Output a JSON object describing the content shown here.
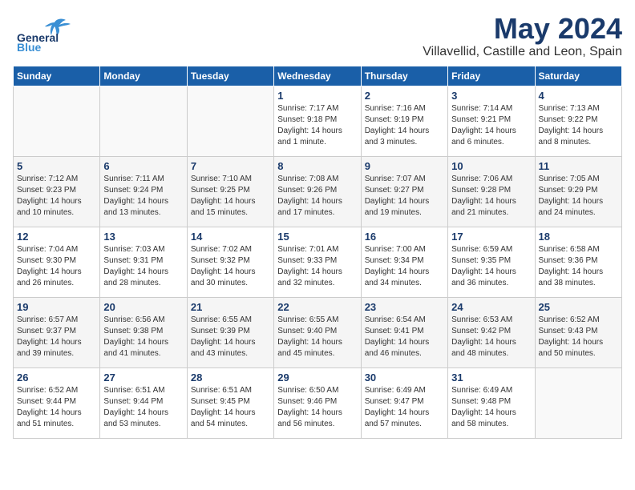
{
  "header": {
    "logo_general": "General",
    "logo_blue": "Blue",
    "title": "May 2024",
    "subtitle": "Villavellid, Castille and Leon, Spain"
  },
  "days_of_week": [
    "Sunday",
    "Monday",
    "Tuesday",
    "Wednesday",
    "Thursday",
    "Friday",
    "Saturday"
  ],
  "weeks": [
    [
      {
        "num": "",
        "sunrise": "",
        "sunset": "",
        "daylight": ""
      },
      {
        "num": "",
        "sunrise": "",
        "sunset": "",
        "daylight": ""
      },
      {
        "num": "",
        "sunrise": "",
        "sunset": "",
        "daylight": ""
      },
      {
        "num": "1",
        "sunrise": "Sunrise: 7:17 AM",
        "sunset": "Sunset: 9:18 PM",
        "daylight": "Daylight: 14 hours and 1 minute."
      },
      {
        "num": "2",
        "sunrise": "Sunrise: 7:16 AM",
        "sunset": "Sunset: 9:19 PM",
        "daylight": "Daylight: 14 hours and 3 minutes."
      },
      {
        "num": "3",
        "sunrise": "Sunrise: 7:14 AM",
        "sunset": "Sunset: 9:21 PM",
        "daylight": "Daylight: 14 hours and 6 minutes."
      },
      {
        "num": "4",
        "sunrise": "Sunrise: 7:13 AM",
        "sunset": "Sunset: 9:22 PM",
        "daylight": "Daylight: 14 hours and 8 minutes."
      }
    ],
    [
      {
        "num": "5",
        "sunrise": "Sunrise: 7:12 AM",
        "sunset": "Sunset: 9:23 PM",
        "daylight": "Daylight: 14 hours and 10 minutes."
      },
      {
        "num": "6",
        "sunrise": "Sunrise: 7:11 AM",
        "sunset": "Sunset: 9:24 PM",
        "daylight": "Daylight: 14 hours and 13 minutes."
      },
      {
        "num": "7",
        "sunrise": "Sunrise: 7:10 AM",
        "sunset": "Sunset: 9:25 PM",
        "daylight": "Daylight: 14 hours and 15 minutes."
      },
      {
        "num": "8",
        "sunrise": "Sunrise: 7:08 AM",
        "sunset": "Sunset: 9:26 PM",
        "daylight": "Daylight: 14 hours and 17 minutes."
      },
      {
        "num": "9",
        "sunrise": "Sunrise: 7:07 AM",
        "sunset": "Sunset: 9:27 PM",
        "daylight": "Daylight: 14 hours and 19 minutes."
      },
      {
        "num": "10",
        "sunrise": "Sunrise: 7:06 AM",
        "sunset": "Sunset: 9:28 PM",
        "daylight": "Daylight: 14 hours and 21 minutes."
      },
      {
        "num": "11",
        "sunrise": "Sunrise: 7:05 AM",
        "sunset": "Sunset: 9:29 PM",
        "daylight": "Daylight: 14 hours and 24 minutes."
      }
    ],
    [
      {
        "num": "12",
        "sunrise": "Sunrise: 7:04 AM",
        "sunset": "Sunset: 9:30 PM",
        "daylight": "Daylight: 14 hours and 26 minutes."
      },
      {
        "num": "13",
        "sunrise": "Sunrise: 7:03 AM",
        "sunset": "Sunset: 9:31 PM",
        "daylight": "Daylight: 14 hours and 28 minutes."
      },
      {
        "num": "14",
        "sunrise": "Sunrise: 7:02 AM",
        "sunset": "Sunset: 9:32 PM",
        "daylight": "Daylight: 14 hours and 30 minutes."
      },
      {
        "num": "15",
        "sunrise": "Sunrise: 7:01 AM",
        "sunset": "Sunset: 9:33 PM",
        "daylight": "Daylight: 14 hours and 32 minutes."
      },
      {
        "num": "16",
        "sunrise": "Sunrise: 7:00 AM",
        "sunset": "Sunset: 9:34 PM",
        "daylight": "Daylight: 14 hours and 34 minutes."
      },
      {
        "num": "17",
        "sunrise": "Sunrise: 6:59 AM",
        "sunset": "Sunset: 9:35 PM",
        "daylight": "Daylight: 14 hours and 36 minutes."
      },
      {
        "num": "18",
        "sunrise": "Sunrise: 6:58 AM",
        "sunset": "Sunset: 9:36 PM",
        "daylight": "Daylight: 14 hours and 38 minutes."
      }
    ],
    [
      {
        "num": "19",
        "sunrise": "Sunrise: 6:57 AM",
        "sunset": "Sunset: 9:37 PM",
        "daylight": "Daylight: 14 hours and 39 minutes."
      },
      {
        "num": "20",
        "sunrise": "Sunrise: 6:56 AM",
        "sunset": "Sunset: 9:38 PM",
        "daylight": "Daylight: 14 hours and 41 minutes."
      },
      {
        "num": "21",
        "sunrise": "Sunrise: 6:55 AM",
        "sunset": "Sunset: 9:39 PM",
        "daylight": "Daylight: 14 hours and 43 minutes."
      },
      {
        "num": "22",
        "sunrise": "Sunrise: 6:55 AM",
        "sunset": "Sunset: 9:40 PM",
        "daylight": "Daylight: 14 hours and 45 minutes."
      },
      {
        "num": "23",
        "sunrise": "Sunrise: 6:54 AM",
        "sunset": "Sunset: 9:41 PM",
        "daylight": "Daylight: 14 hours and 46 minutes."
      },
      {
        "num": "24",
        "sunrise": "Sunrise: 6:53 AM",
        "sunset": "Sunset: 9:42 PM",
        "daylight": "Daylight: 14 hours and 48 minutes."
      },
      {
        "num": "25",
        "sunrise": "Sunrise: 6:52 AM",
        "sunset": "Sunset: 9:43 PM",
        "daylight": "Daylight: 14 hours and 50 minutes."
      }
    ],
    [
      {
        "num": "26",
        "sunrise": "Sunrise: 6:52 AM",
        "sunset": "Sunset: 9:44 PM",
        "daylight": "Daylight: 14 hours and 51 minutes."
      },
      {
        "num": "27",
        "sunrise": "Sunrise: 6:51 AM",
        "sunset": "Sunset: 9:44 PM",
        "daylight": "Daylight: 14 hours and 53 minutes."
      },
      {
        "num": "28",
        "sunrise": "Sunrise: 6:51 AM",
        "sunset": "Sunset: 9:45 PM",
        "daylight": "Daylight: 14 hours and 54 minutes."
      },
      {
        "num": "29",
        "sunrise": "Sunrise: 6:50 AM",
        "sunset": "Sunset: 9:46 PM",
        "daylight": "Daylight: 14 hours and 56 minutes."
      },
      {
        "num": "30",
        "sunrise": "Sunrise: 6:49 AM",
        "sunset": "Sunset: 9:47 PM",
        "daylight": "Daylight: 14 hours and 57 minutes."
      },
      {
        "num": "31",
        "sunrise": "Sunrise: 6:49 AM",
        "sunset": "Sunset: 9:48 PM",
        "daylight": "Daylight: 14 hours and 58 minutes."
      },
      {
        "num": "",
        "sunrise": "",
        "sunset": "",
        "daylight": ""
      }
    ]
  ]
}
